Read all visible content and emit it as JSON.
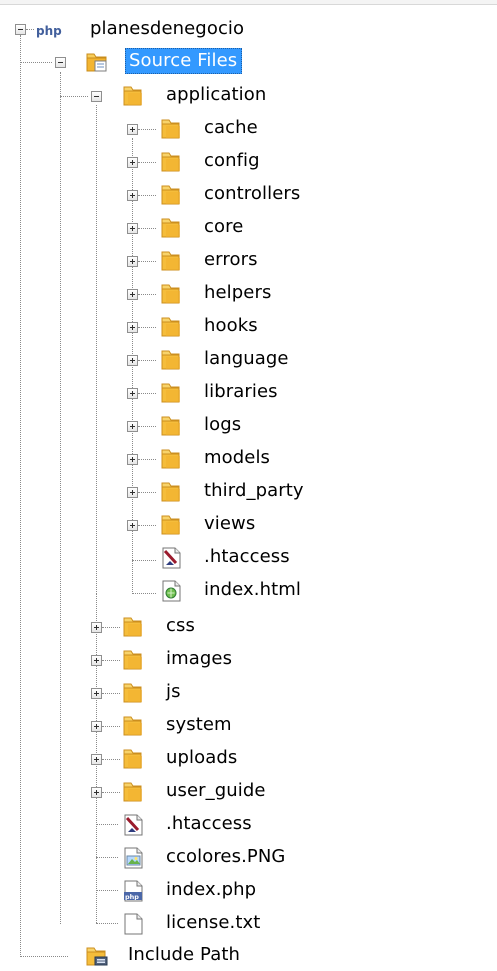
{
  "window": {
    "theme_colors": {
      "selection": "#3399ff",
      "selection_text": "#ffffff",
      "tree_line": "#8a8a8a",
      "folder": "#f6c343",
      "folder_dark": "#d8961a"
    }
  },
  "project": {
    "badge": "php",
    "name": "planesdenegocio",
    "source_files": {
      "label": "Source Files",
      "selected": true,
      "application": {
        "label": "application",
        "children": [
          {
            "label": "cache",
            "type": "folder",
            "icon": "folder-icon"
          },
          {
            "label": "config",
            "type": "folder",
            "icon": "folder-icon"
          },
          {
            "label": "controllers",
            "type": "folder",
            "icon": "folder-icon"
          },
          {
            "label": "core",
            "type": "folder",
            "icon": "folder-icon"
          },
          {
            "label": "errors",
            "type": "folder",
            "icon": "folder-icon"
          },
          {
            "label": "helpers",
            "type": "folder",
            "icon": "folder-icon"
          },
          {
            "label": "hooks",
            "type": "folder",
            "icon": "folder-icon"
          },
          {
            "label": "language",
            "type": "folder",
            "icon": "folder-icon"
          },
          {
            "label": "libraries",
            "type": "folder",
            "icon": "folder-icon"
          },
          {
            "label": "logs",
            "type": "folder",
            "icon": "folder-icon"
          },
          {
            "label": "models",
            "type": "folder",
            "icon": "folder-icon"
          },
          {
            "label": "third_party",
            "type": "folder",
            "icon": "folder-icon"
          },
          {
            "label": "views",
            "type": "folder",
            "icon": "folder-icon"
          },
          {
            "label": ".htaccess",
            "type": "file",
            "icon": "htaccess-file-icon"
          },
          {
            "label": "index.html",
            "type": "file",
            "icon": "html-file-icon"
          }
        ]
      },
      "children": [
        {
          "label": "css",
          "type": "folder",
          "icon": "folder-icon"
        },
        {
          "label": "images",
          "type": "folder",
          "icon": "folder-icon"
        },
        {
          "label": "js",
          "type": "folder",
          "icon": "folder-icon"
        },
        {
          "label": "system",
          "type": "folder",
          "icon": "folder-icon"
        },
        {
          "label": "uploads",
          "type": "folder",
          "icon": "folder-icon"
        },
        {
          "label": "user_guide",
          "type": "folder",
          "icon": "folder-icon"
        },
        {
          "label": ".htaccess",
          "type": "file",
          "icon": "htaccess-file-icon"
        },
        {
          "label": "ccolores.PNG",
          "type": "file",
          "icon": "image-file-icon"
        },
        {
          "label": "index.php",
          "type": "file",
          "icon": "php-file-icon",
          "badge": "php"
        },
        {
          "label": "license.txt",
          "type": "file",
          "icon": "text-file-icon"
        }
      ]
    },
    "include_path": {
      "label": "Include Path"
    }
  }
}
